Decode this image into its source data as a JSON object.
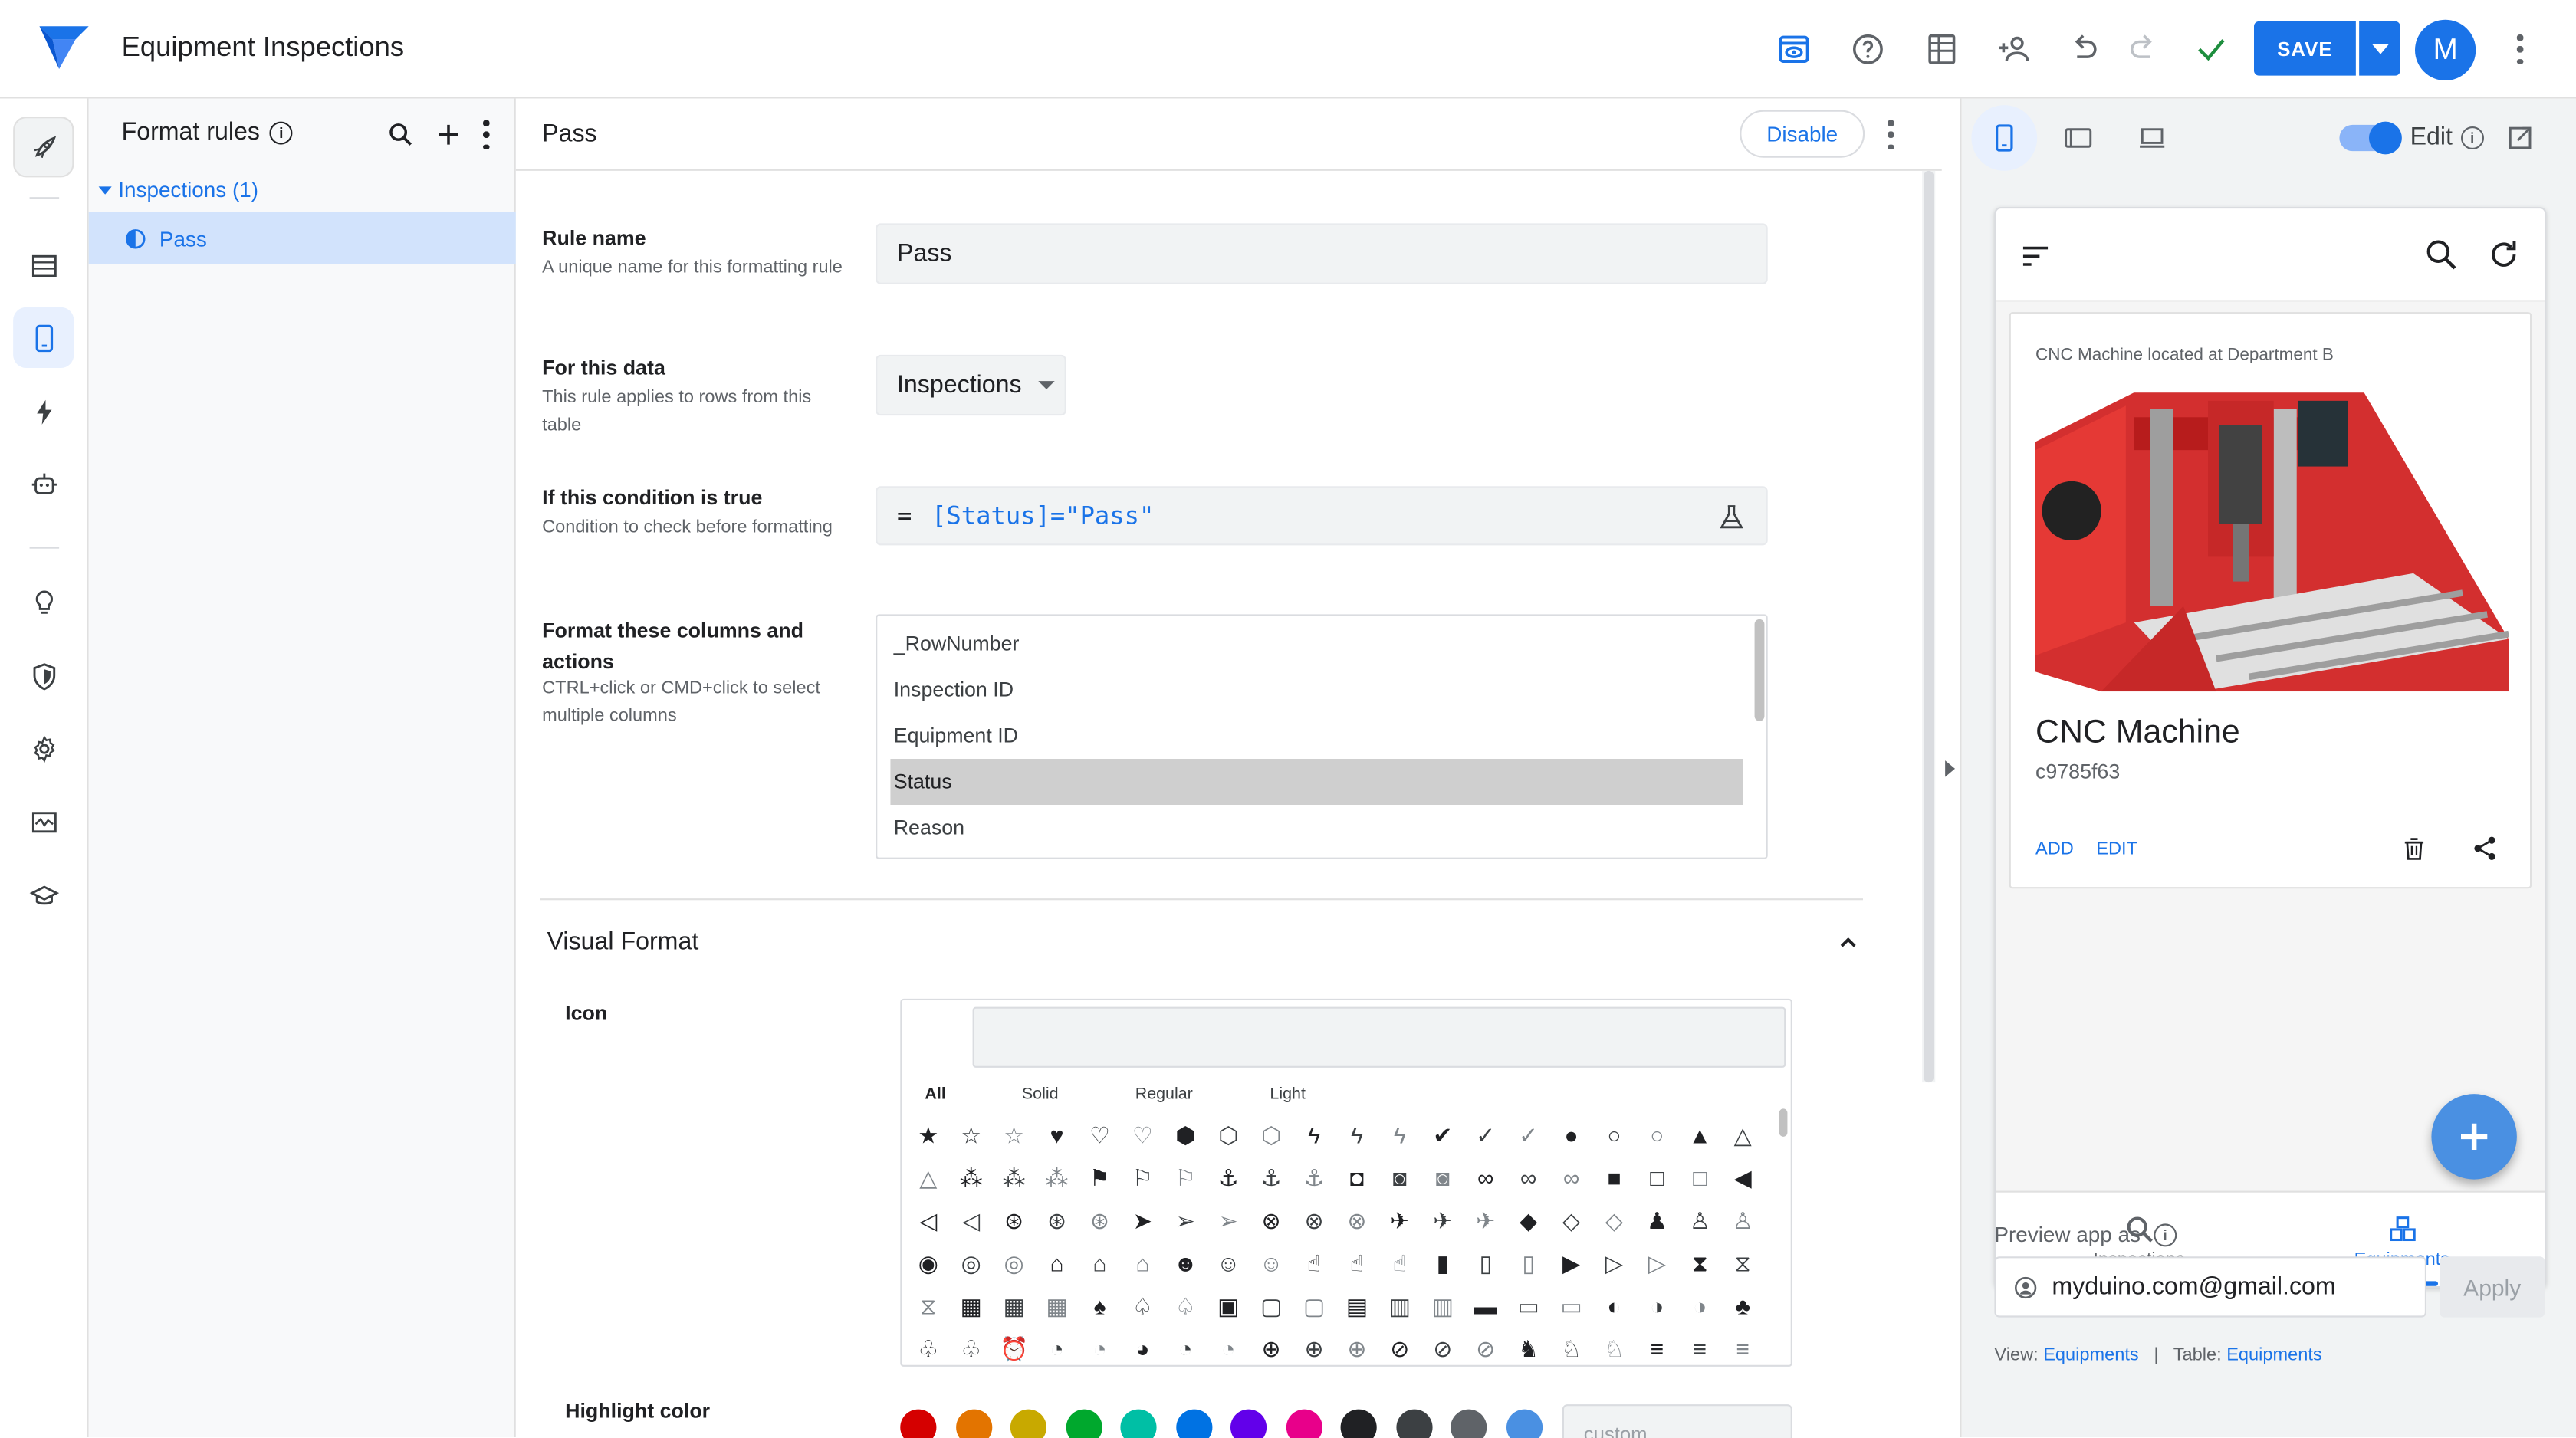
{
  "app": {
    "title": "Equipment Inspections"
  },
  "topbar": {
    "save_label": "SAVE",
    "avatar_initial": "M"
  },
  "rules_panel": {
    "title": "Format rules",
    "group_label": "Inspections (1)",
    "items": [
      {
        "label": "Pass"
      }
    ]
  },
  "editor": {
    "title": "Pass",
    "disable_label": "Disable",
    "rule_name": {
      "label": "Rule name",
      "help": "A unique name for this formatting rule",
      "value": "Pass"
    },
    "for_data": {
      "label": "For this data",
      "help": "This rule applies to rows from this table",
      "value": "Inspections"
    },
    "condition": {
      "label": "If this condition is true",
      "help": "Condition to check before formatting",
      "prefix": "=",
      "value": "[Status]=\"Pass\""
    },
    "columns": {
      "label": "Format these columns and actions",
      "help": "CTRL+click or CMD+click to select multiple columns",
      "options": [
        "_RowNumber",
        "Inspection ID",
        "Equipment ID",
        "Status",
        "Reason"
      ],
      "selected": "Status"
    },
    "visual_format": {
      "title": "Visual Format",
      "icon_label": "Icon",
      "icon_tabs": [
        "All",
        "Solid",
        "Regular",
        "Light"
      ],
      "active_tab": "All",
      "highlight_label": "Highlight color",
      "custom_placeholder": "custom",
      "colors": [
        "#d50000",
        "#e37400",
        "#c8a900",
        "#00a82d",
        "#00bfa5",
        "#0072e3",
        "#6200ea",
        "#e8008a",
        "#202124",
        "#3c4043",
        "#5f6368",
        "#4a90e2"
      ]
    }
  },
  "preview": {
    "edit_label": "Edit",
    "card": {
      "subtitle": "CNC Machine located at Department B",
      "title": "CNC Machine",
      "id": "c9785f63",
      "add_label": "ADD",
      "edit_label": "EDIT"
    },
    "nav": [
      {
        "label": "Inspections"
      },
      {
        "label": "Equipments"
      }
    ],
    "preview_as_label": "Preview app as",
    "email": "myduino.com@gmail.com",
    "apply_label": "Apply",
    "footer": {
      "view_label": "View:",
      "view_value": "Equipments",
      "sep": "|",
      "table_label": "Table:",
      "table_value": "Equipments"
    }
  }
}
